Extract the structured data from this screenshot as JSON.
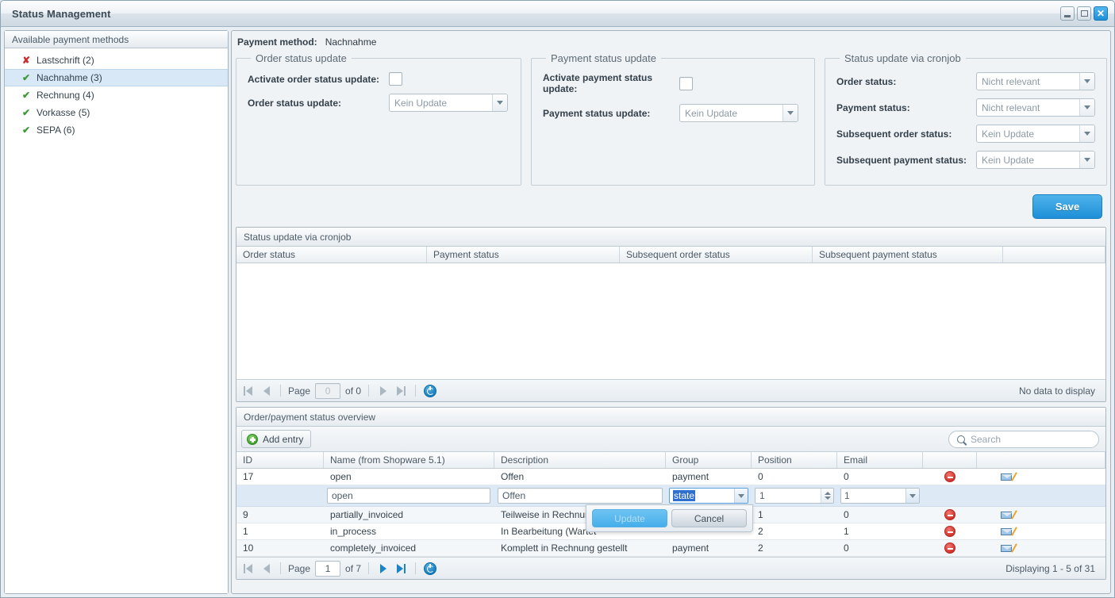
{
  "window": {
    "title": "Status Management",
    "buttons": {
      "minimize": "–",
      "maximize": "□",
      "close": "✕"
    }
  },
  "sidebar": {
    "header": "Available payment methods",
    "items": [
      {
        "label": "Lastschrift (2)",
        "icon": "cross-icon",
        "glyph": "✘",
        "active": false,
        "selected": false
      },
      {
        "label": "Nachnahme (3)",
        "icon": "check-icon",
        "glyph": "✔",
        "active": true,
        "selected": true
      },
      {
        "label": "Rechnung (4)",
        "icon": "check-icon",
        "glyph": "✔",
        "active": true,
        "selected": false
      },
      {
        "label": "Vorkasse (5)",
        "icon": "check-icon",
        "glyph": "✔",
        "active": true,
        "selected": false
      },
      {
        "label": "SEPA (6)",
        "icon": "check-icon",
        "glyph": "✔",
        "active": true,
        "selected": false
      }
    ]
  },
  "header": {
    "payment_method_label": "Payment method:",
    "payment_method_value": "Nachnahme"
  },
  "order_status_update": {
    "legend": "Order status update",
    "activate_label": "Activate order status update:",
    "activate_checked": false,
    "update_label": "Order status update:",
    "update_value": "Kein Update"
  },
  "payment_status_update": {
    "legend": "Payment status update",
    "activate_label": "Activate payment status update:",
    "activate_checked": false,
    "update_label": "Payment status update:",
    "update_value": "Kein Update"
  },
  "cronjob_update": {
    "legend": "Status update via cronjob",
    "fields": [
      {
        "label": "Order status:",
        "value": "Nicht relevant"
      },
      {
        "label": "Payment status:",
        "value": "Nicht relevant"
      },
      {
        "label": "Subsequent order status:",
        "value": "Kein Update"
      },
      {
        "label": "Subsequent payment status:",
        "value": "Kein Update"
      }
    ]
  },
  "save_button": {
    "label": "Save",
    "color": "#1e8fd8"
  },
  "cronjob_grid": {
    "title": "Status update via cronjob",
    "columns": [
      "Order status",
      "Payment status",
      "Subsequent order status",
      "Subsequent payment status",
      ""
    ],
    "rows": [],
    "pager": {
      "page_label": "Page",
      "page_value": "0",
      "of_label": "of 0",
      "status": "No data to display",
      "refresh_icon": "refresh-icon"
    }
  },
  "overview_grid": {
    "title": "Order/payment status overview",
    "add_button": "Add entry",
    "add_icon": "plus-icon",
    "search": {
      "placeholder": "Search",
      "value": "",
      "icon": "search-icon"
    },
    "columns": [
      "ID",
      "Name (from Shopware 5.1)",
      "Description",
      "Group",
      "Position",
      "Email",
      "",
      ""
    ],
    "rows": [
      {
        "id": "17",
        "name": "open",
        "description": "Offen",
        "group": "payment",
        "position": "0",
        "email": "0",
        "delete_icon": "delete-icon",
        "edit_icon": "mail-edit-icon"
      },
      {
        "id": "9",
        "name": "partially_invoiced",
        "description": "Teilweise in Rechnung",
        "group": "",
        "position": "1",
        "email": "0",
        "delete_icon": "delete-icon",
        "edit_icon": "mail-edit-icon"
      },
      {
        "id": "1",
        "name": "in_process",
        "description": "In Bearbeitung (Wartet",
        "group": "",
        "position": "2",
        "email": "1",
        "delete_icon": "delete-icon",
        "edit_icon": "mail-edit-icon"
      },
      {
        "id": "10",
        "name": "completely_invoiced",
        "description": "Komplett in Rechnung gestellt",
        "group": "payment",
        "position": "2",
        "email": "0",
        "delete_icon": "delete-icon",
        "edit_icon": "mail-edit-icon"
      }
    ],
    "edit_row": {
      "id": "",
      "name": "open",
      "description": "Offen",
      "group": "state",
      "group_selected": true,
      "position": "1",
      "email": "1",
      "update_button": "Update",
      "cancel_button": "Cancel"
    },
    "pager": {
      "page_label": "Page",
      "page_value": "1",
      "of_label": "of 7",
      "status": "Displaying 1 - 5 of 31",
      "refresh_icon": "refresh-icon"
    }
  }
}
